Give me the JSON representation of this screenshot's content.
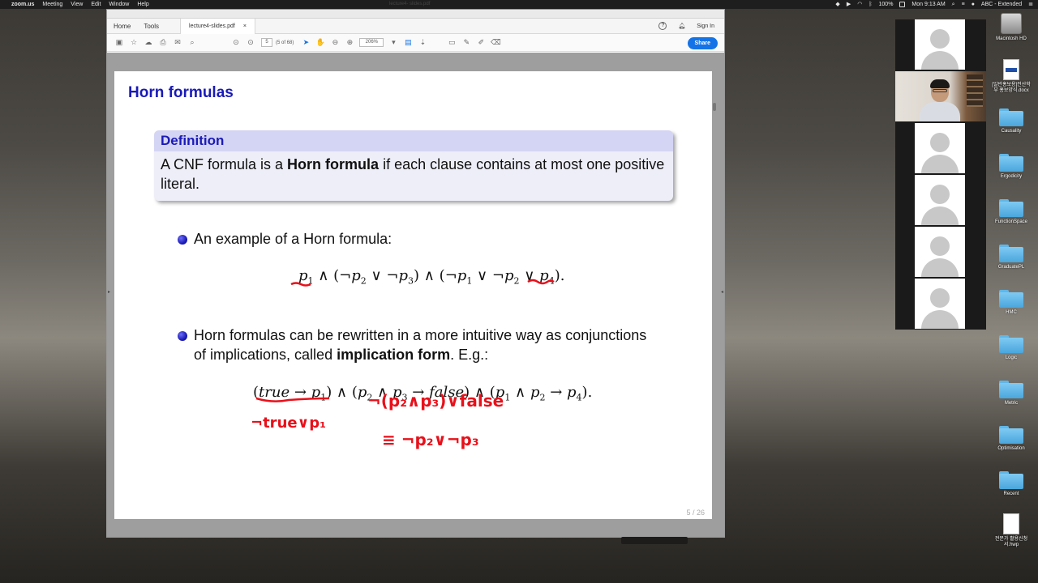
{
  "menubar": {
    "app": "zoom.us",
    "items": [
      "Meeting",
      "View",
      "Edit",
      "Window",
      "Help"
    ],
    "battery": "100%",
    "datetime": "Mon 9:13 AM",
    "input_source": "ABC - Extended",
    "center_title": "lecture4- slides.pdf"
  },
  "acrobat": {
    "tabs": {
      "home": "Home",
      "tools": "Tools",
      "document": "lecture4-slides.pdf",
      "close": "×"
    },
    "sign_in": "Sign In",
    "page_current": "5",
    "page_of": "(5 of 68)",
    "zoom": "206%",
    "share": "Share"
  },
  "slide": {
    "title": "Horn formulas",
    "definition": {
      "heading": "Definition",
      "text_before": "A CNF formula is a ",
      "bold": "Horn formula",
      "text_after": " if each clause contains at most one positive literal."
    },
    "bullet1": "An example of a Horn formula:",
    "bullet2_before": "Horn formulas can be rewritten in a more intuitive way as conjunctions of implications, called ",
    "bullet2_bold": "implication form",
    "bullet2_after": ". E.g.:",
    "page_number": "5 / 26",
    "handwriting": {
      "line1": "¬(p₂∧p₃)∨false",
      "line2": "¬true∨p₁",
      "line3": "≡ ¬p₂∨¬p₃"
    }
  },
  "desktop": {
    "icons": [
      {
        "label": "Macintosh HD",
        "kind": "drive"
      },
      {
        "label": "[일반홍보용]전산학부 홍보양식.docx",
        "kind": "doc"
      },
      {
        "label": "Causality",
        "kind": "folder"
      },
      {
        "label": "Ergodicity",
        "kind": "folder"
      },
      {
        "label": "FunctionSpace",
        "kind": "folder"
      },
      {
        "label": "GraduatePL",
        "kind": "folder"
      },
      {
        "label": "HMC",
        "kind": "folder"
      },
      {
        "label": "Logic",
        "kind": "folder"
      },
      {
        "label": "Metric",
        "kind": "folder"
      },
      {
        "label": "Optimisation",
        "kind": "folder"
      },
      {
        "label": "Recent",
        "kind": "folder"
      },
      {
        "label": "전문가 활용신청서.hwp",
        "kind": "doc"
      }
    ]
  },
  "colors": {
    "slide_title": "#1a1ab8",
    "block_header_bg": "#d4d4f4",
    "block_body_bg": "#eeeef9",
    "annotation": "#e8101a",
    "acrobat_blue": "#1473e6"
  }
}
